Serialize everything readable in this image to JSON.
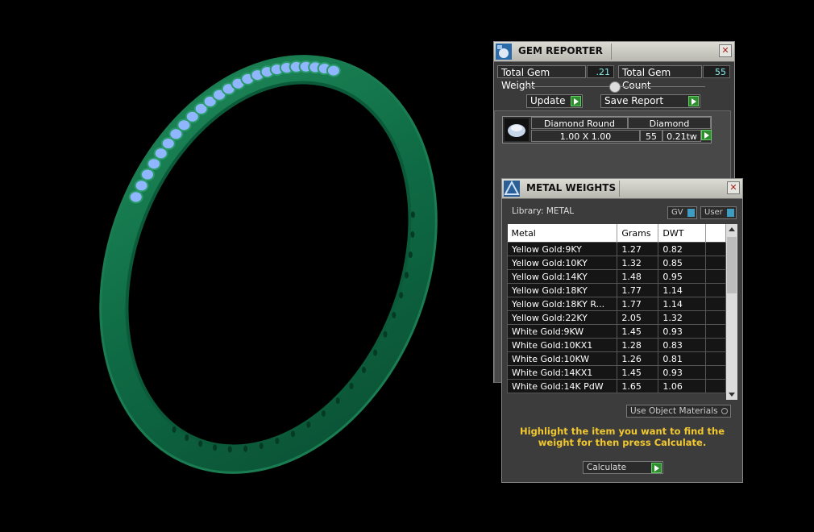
{
  "gem_reporter": {
    "title": "GEM REPORTER",
    "total_gem_weight_label": "Total Gem Weight",
    "total_gem_weight_value": ".21",
    "total_gem_count_label": "Total Gem Count",
    "total_gem_count_value": "55",
    "update_label": "Update",
    "save_report_label": "Save Report",
    "gem": {
      "shape": "Diamond Round",
      "material": "Diamond",
      "size": "1.00 X 1.00",
      "count": "55",
      "weight": "0.21tw"
    }
  },
  "metal_weights": {
    "title": "METAL WEIGHTS",
    "library_label": "Library: METAL",
    "gv_label": "GV",
    "user_label": "User",
    "columns": [
      "Metal",
      "Grams",
      "DWT"
    ],
    "rows": [
      [
        "Yellow Gold:9KY",
        "1.27",
        "0.82"
      ],
      [
        "Yellow Gold:10KY",
        "1.32",
        "0.85"
      ],
      [
        "Yellow Gold:14KY",
        "1.48",
        "0.95"
      ],
      [
        "Yellow Gold:18KY",
        "1.77",
        "1.14"
      ],
      [
        "Yellow Gold:18KY R...",
        "1.77",
        "1.14"
      ],
      [
        "Yellow Gold:22KY",
        "2.05",
        "1.32"
      ],
      [
        "White Gold:9KW",
        "1.45",
        "0.93"
      ],
      [
        "White Gold:10KX1",
        "1.28",
        "0.83"
      ],
      [
        "White Gold:10KW",
        "1.26",
        "0.81"
      ],
      [
        "White Gold:14KX1",
        "1.45",
        "0.93"
      ],
      [
        "White Gold:14K PdW",
        "1.65",
        "1.06"
      ]
    ],
    "use_object_materials_label": "Use Object Materials",
    "hint": "Highlight the item you want to find the weight for then press Calculate.",
    "calculate_label": "Calculate"
  },
  "colors": {
    "ring_green": "#0f6b45",
    "gem_blue": "#8fb6ff",
    "hint_yellow": "#f2c830",
    "play_green": "#2f8c2f"
  }
}
